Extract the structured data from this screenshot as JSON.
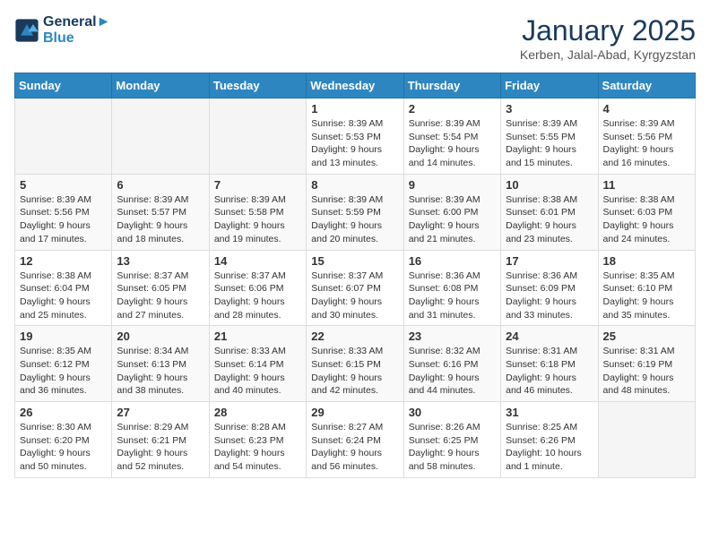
{
  "header": {
    "logo_line1": "General",
    "logo_line2": "Blue",
    "month": "January 2025",
    "location": "Kerben, Jalal-Abad, Kyrgyzstan"
  },
  "weekdays": [
    "Sunday",
    "Monday",
    "Tuesday",
    "Wednesday",
    "Thursday",
    "Friday",
    "Saturday"
  ],
  "weeks": [
    [
      {
        "day": "",
        "empty": true
      },
      {
        "day": "",
        "empty": true
      },
      {
        "day": "",
        "empty": true
      },
      {
        "day": "1",
        "sunrise": "8:39 AM",
        "sunset": "5:53 PM",
        "daylight": "9 hours and 13 minutes."
      },
      {
        "day": "2",
        "sunrise": "8:39 AM",
        "sunset": "5:54 PM",
        "daylight": "9 hours and 14 minutes."
      },
      {
        "day": "3",
        "sunrise": "8:39 AM",
        "sunset": "5:55 PM",
        "daylight": "9 hours and 15 minutes."
      },
      {
        "day": "4",
        "sunrise": "8:39 AM",
        "sunset": "5:56 PM",
        "daylight": "9 hours and 16 minutes."
      }
    ],
    [
      {
        "day": "5",
        "sunrise": "8:39 AM",
        "sunset": "5:56 PM",
        "daylight": "9 hours and 17 minutes."
      },
      {
        "day": "6",
        "sunrise": "8:39 AM",
        "sunset": "5:57 PM",
        "daylight": "9 hours and 18 minutes."
      },
      {
        "day": "7",
        "sunrise": "8:39 AM",
        "sunset": "5:58 PM",
        "daylight": "9 hours and 19 minutes."
      },
      {
        "day": "8",
        "sunrise": "8:39 AM",
        "sunset": "5:59 PM",
        "daylight": "9 hours and 20 minutes."
      },
      {
        "day": "9",
        "sunrise": "8:39 AM",
        "sunset": "6:00 PM",
        "daylight": "9 hours and 21 minutes."
      },
      {
        "day": "10",
        "sunrise": "8:38 AM",
        "sunset": "6:01 PM",
        "daylight": "9 hours and 23 minutes."
      },
      {
        "day": "11",
        "sunrise": "8:38 AM",
        "sunset": "6:03 PM",
        "daylight": "9 hours and 24 minutes."
      }
    ],
    [
      {
        "day": "12",
        "sunrise": "8:38 AM",
        "sunset": "6:04 PM",
        "daylight": "9 hours and 25 minutes."
      },
      {
        "day": "13",
        "sunrise": "8:37 AM",
        "sunset": "6:05 PM",
        "daylight": "9 hours and 27 minutes."
      },
      {
        "day": "14",
        "sunrise": "8:37 AM",
        "sunset": "6:06 PM",
        "daylight": "9 hours and 28 minutes."
      },
      {
        "day": "15",
        "sunrise": "8:37 AM",
        "sunset": "6:07 PM",
        "daylight": "9 hours and 30 minutes."
      },
      {
        "day": "16",
        "sunrise": "8:36 AM",
        "sunset": "6:08 PM",
        "daylight": "9 hours and 31 minutes."
      },
      {
        "day": "17",
        "sunrise": "8:36 AM",
        "sunset": "6:09 PM",
        "daylight": "9 hours and 33 minutes."
      },
      {
        "day": "18",
        "sunrise": "8:35 AM",
        "sunset": "6:10 PM",
        "daylight": "9 hours and 35 minutes."
      }
    ],
    [
      {
        "day": "19",
        "sunrise": "8:35 AM",
        "sunset": "6:12 PM",
        "daylight": "9 hours and 36 minutes."
      },
      {
        "day": "20",
        "sunrise": "8:34 AM",
        "sunset": "6:13 PM",
        "daylight": "9 hours and 38 minutes."
      },
      {
        "day": "21",
        "sunrise": "8:33 AM",
        "sunset": "6:14 PM",
        "daylight": "9 hours and 40 minutes."
      },
      {
        "day": "22",
        "sunrise": "8:33 AM",
        "sunset": "6:15 PM",
        "daylight": "9 hours and 42 minutes."
      },
      {
        "day": "23",
        "sunrise": "8:32 AM",
        "sunset": "6:16 PM",
        "daylight": "9 hours and 44 minutes."
      },
      {
        "day": "24",
        "sunrise": "8:31 AM",
        "sunset": "6:18 PM",
        "daylight": "9 hours and 46 minutes."
      },
      {
        "day": "25",
        "sunrise": "8:31 AM",
        "sunset": "6:19 PM",
        "daylight": "9 hours and 48 minutes."
      }
    ],
    [
      {
        "day": "26",
        "sunrise": "8:30 AM",
        "sunset": "6:20 PM",
        "daylight": "9 hours and 50 minutes."
      },
      {
        "day": "27",
        "sunrise": "8:29 AM",
        "sunset": "6:21 PM",
        "daylight": "9 hours and 52 minutes."
      },
      {
        "day": "28",
        "sunrise": "8:28 AM",
        "sunset": "6:23 PM",
        "daylight": "9 hours and 54 minutes."
      },
      {
        "day": "29",
        "sunrise": "8:27 AM",
        "sunset": "6:24 PM",
        "daylight": "9 hours and 56 minutes."
      },
      {
        "day": "30",
        "sunrise": "8:26 AM",
        "sunset": "6:25 PM",
        "daylight": "9 hours and 58 minutes."
      },
      {
        "day": "31",
        "sunrise": "8:25 AM",
        "sunset": "6:26 PM",
        "daylight": "10 hours and 1 minute."
      },
      {
        "day": "",
        "empty": true
      }
    ]
  ]
}
